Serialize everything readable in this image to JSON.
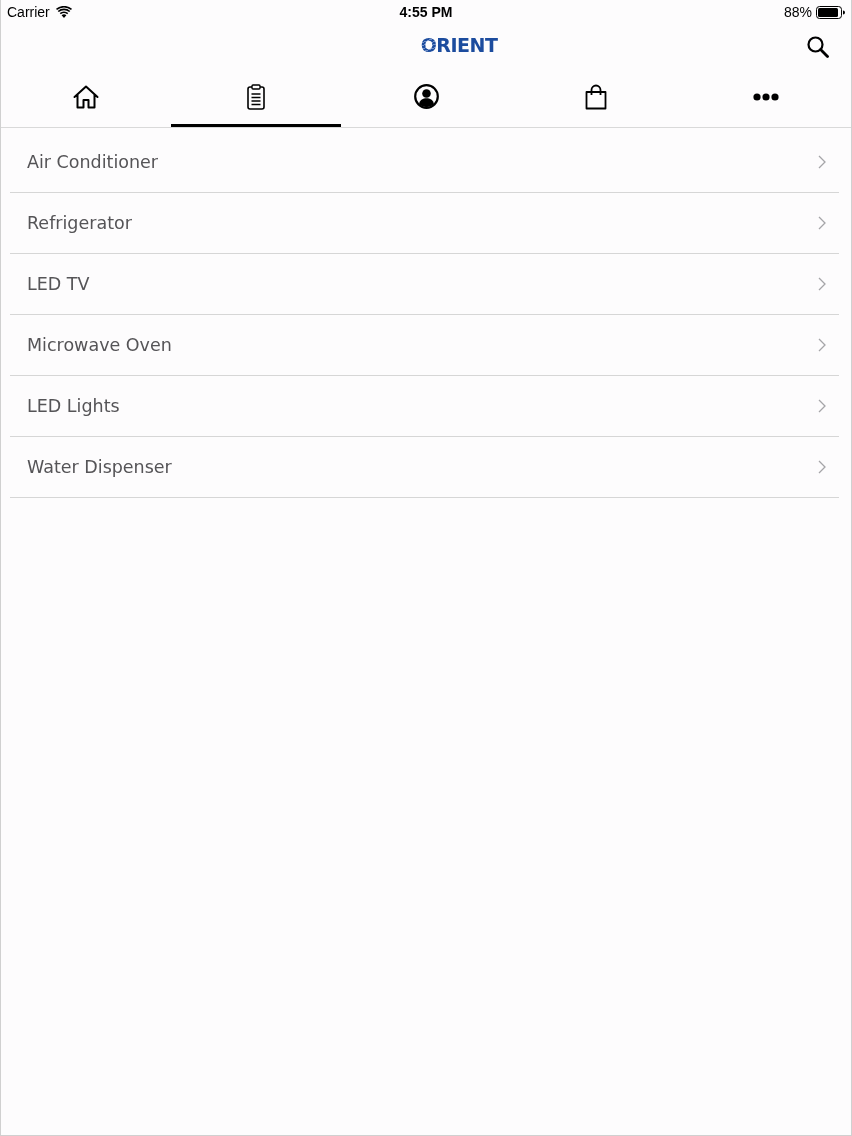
{
  "status_bar": {
    "carrier": "Carrier",
    "time": "4:55 PM",
    "battery": "88%"
  },
  "header": {
    "logo": "ORIENT"
  },
  "tabs": [
    {
      "kind": "home",
      "selected": false
    },
    {
      "kind": "clipboard",
      "selected": true
    },
    {
      "kind": "account",
      "selected": false
    },
    {
      "kind": "bag",
      "selected": false
    },
    {
      "kind": "more",
      "selected": false
    }
  ],
  "categories": [
    {
      "label": "Air Conditioner"
    },
    {
      "label": "Refrigerator"
    },
    {
      "label": "LED TV"
    },
    {
      "label": "Microwave Oven"
    },
    {
      "label": "LED Lights"
    },
    {
      "label": "Water Dispenser"
    }
  ]
}
